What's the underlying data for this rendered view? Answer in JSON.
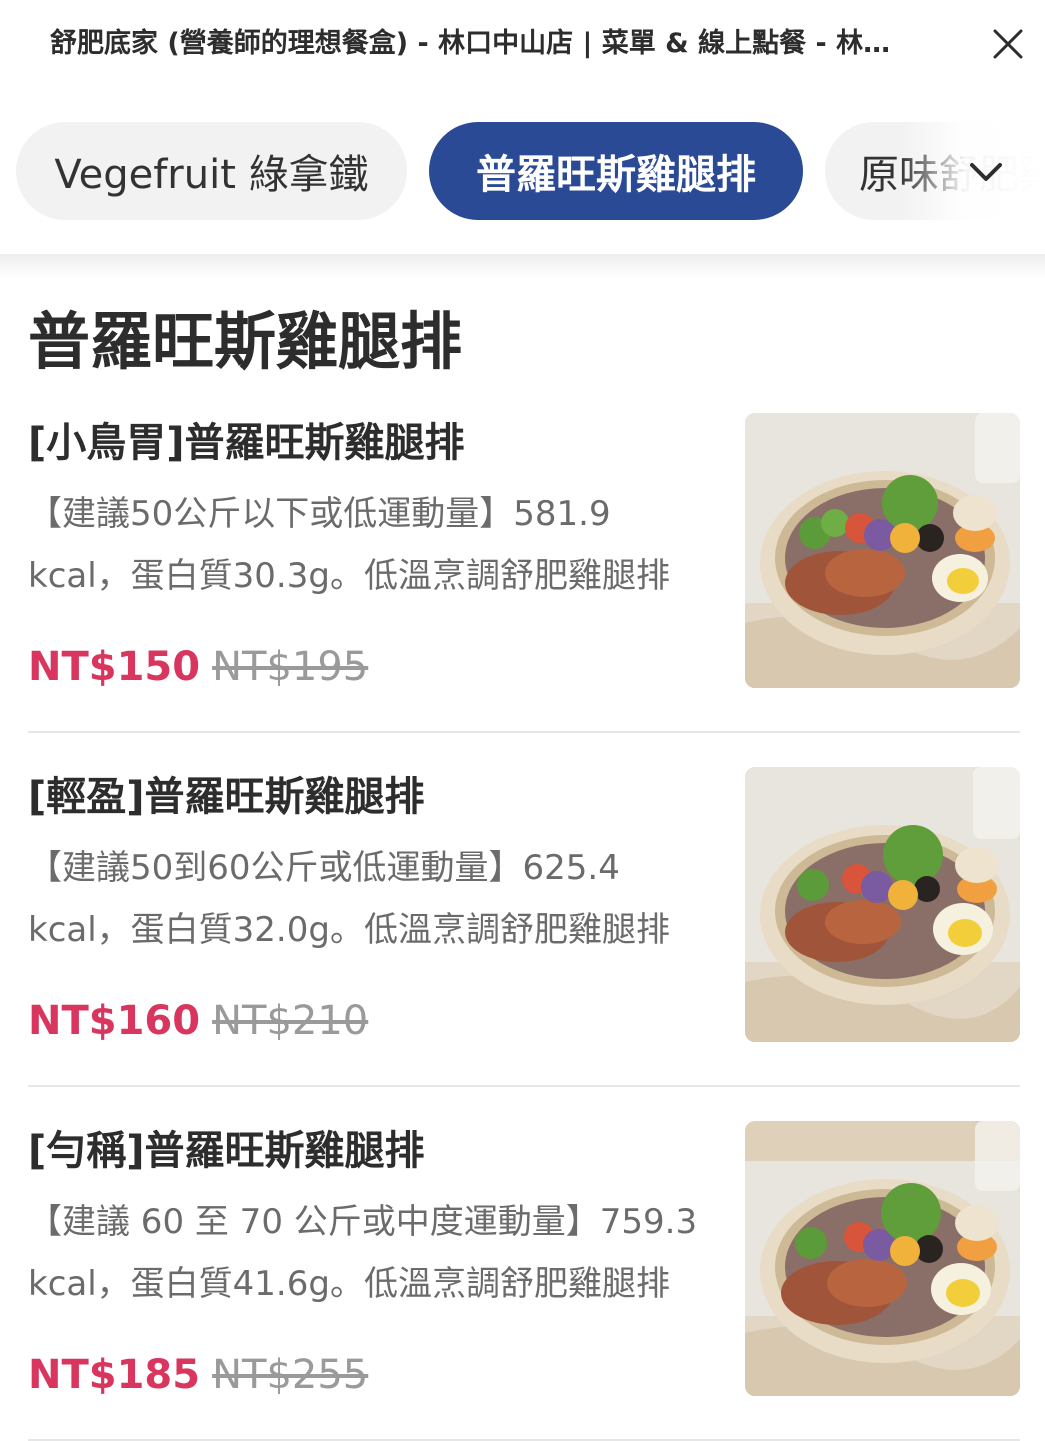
{
  "header": {
    "title": "舒肥底家 (營養師的理想餐盒) - 林口中山店 | 菜單 & 線上點餐 - 林口區 | foodpanda"
  },
  "tabs": [
    {
      "label": "Vegefruit 綠拿鐵",
      "active": false
    },
    {
      "label": "普羅旺斯雞腿排",
      "active": true
    },
    {
      "label": "原味舒肥雞胸",
      "active": false
    }
  ],
  "section": {
    "title": "普羅旺斯雞腿排"
  },
  "items": [
    {
      "name": "[小鳥胃]普羅旺斯雞腿排",
      "description": "【建議50公斤以下或低運動量】581.9 kcal，蛋白質30.3g。低溫烹調舒肥雞腿排",
      "price": "NT$150",
      "original_price": "NT$195"
    },
    {
      "name": "[輕盈]普羅旺斯雞腿排",
      "description": "【建議50到60公斤或低運動量】625.4 kcal，蛋白質32.0g。低溫烹調舒肥雞腿排",
      "price": "NT$160",
      "original_price": "NT$210"
    },
    {
      "name": "[勻稱]普羅旺斯雞腿排",
      "description": "【建議 60 至 70 公斤或中度運動量】759.3 kcal，蛋白質41.6g。低溫烹調舒肥雞腿排",
      "price": "NT$185",
      "original_price": "NT$255"
    }
  ],
  "colors": {
    "active_tab": "#2a4a96",
    "price": "#d8365e"
  },
  "icons": {
    "close": "close-icon",
    "more": "chevron-down-icon"
  }
}
